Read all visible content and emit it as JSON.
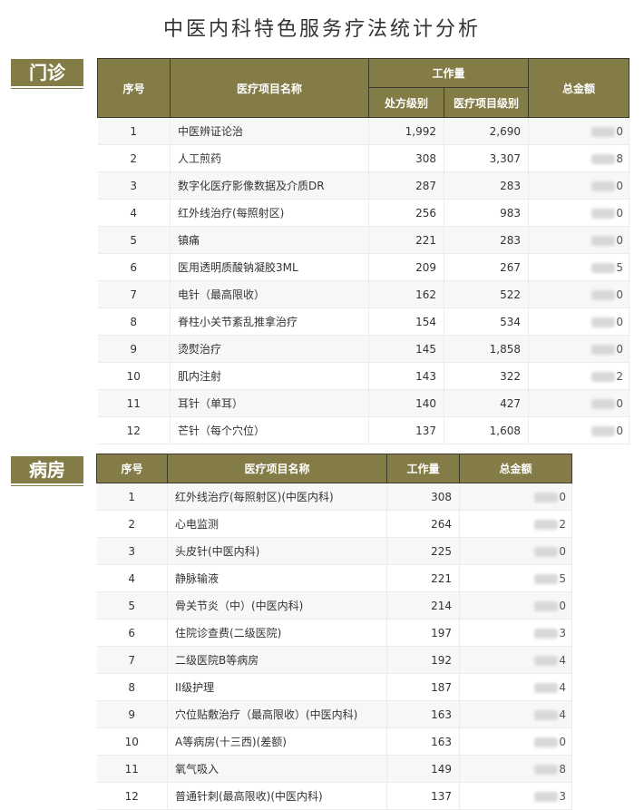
{
  "title": "中医内科特色服务疗法统计分析",
  "outpatient": {
    "label": "门诊",
    "headers": {
      "index": "序号",
      "name": "医疗项目名称",
      "workload": "工作量",
      "rx_level": "处方级别",
      "item_level": "医疗项目级别",
      "amount": "总金额"
    },
    "rows": [
      {
        "idx": "1",
        "name": "中医辨证论治",
        "rx": "1,992",
        "item": "2,690",
        "amt_last": "0"
      },
      {
        "idx": "2",
        "name": "人工煎药",
        "rx": "308",
        "item": "3,307",
        "amt_last": "8"
      },
      {
        "idx": "3",
        "name": "数字化医疗影像数据及介质DR",
        "rx": "287",
        "item": "283",
        "amt_last": "0"
      },
      {
        "idx": "4",
        "name": "红外线治疗(每照射区)",
        "rx": "256",
        "item": "983",
        "amt_last": "0"
      },
      {
        "idx": "5",
        "name": "镇痛",
        "rx": "221",
        "item": "283",
        "amt_last": "0"
      },
      {
        "idx": "6",
        "name": "医用透明质酸钠凝胶3ML",
        "rx": "209",
        "item": "267",
        "amt_last": "5"
      },
      {
        "idx": "7",
        "name": "电针（最高限收）",
        "rx": "162",
        "item": "522",
        "amt_last": "0"
      },
      {
        "idx": "8",
        "name": "脊柱小关节紊乱推拿治疗",
        "rx": "154",
        "item": "534",
        "amt_last": "0"
      },
      {
        "idx": "9",
        "name": "烫熨治疗",
        "rx": "145",
        "item": "1,858",
        "amt_last": "0"
      },
      {
        "idx": "10",
        "name": "肌内注射",
        "rx": "143",
        "item": "322",
        "amt_last": "2"
      },
      {
        "idx": "11",
        "name": "耳针（单耳）",
        "rx": "140",
        "item": "427",
        "amt_last": "0"
      },
      {
        "idx": "12",
        "name": "芒针（每个穴位）",
        "rx": "137",
        "item": "1,608",
        "amt_last": "0"
      }
    ]
  },
  "ward": {
    "label": "病房",
    "headers": {
      "index": "序号",
      "name": "医疗项目名称",
      "workload": "工作量",
      "amount": "总金额"
    },
    "rows": [
      {
        "idx": "1",
        "name": "红外线治疗(每照射区)(中医内科)",
        "work": "308",
        "amt_last": "0"
      },
      {
        "idx": "2",
        "name": "心电监测",
        "work": "264",
        "amt_last": "2"
      },
      {
        "idx": "3",
        "name": "头皮针(中医内科)",
        "work": "225",
        "amt_last": "0"
      },
      {
        "idx": "4",
        "name": "静脉输液",
        "work": "221",
        "amt_last": "5"
      },
      {
        "idx": "5",
        "name": "骨关节炎（中）(中医内科)",
        "work": "214",
        "amt_last": "0"
      },
      {
        "idx": "6",
        "name": "住院诊查费(二级医院)",
        "work": "197",
        "amt_last": "3"
      },
      {
        "idx": "7",
        "name": "二级医院B等病房",
        "work": "192",
        "amt_last": "4"
      },
      {
        "idx": "8",
        "name": "II级护理",
        "work": "187",
        "amt_last": "4"
      },
      {
        "idx": "9",
        "name": "穴位贴敷治疗（最高限收）(中医内科)",
        "work": "163",
        "amt_last": "4"
      },
      {
        "idx": "10",
        "name": "A等病房(十三西)(差额)",
        "work": "163",
        "amt_last": "0"
      },
      {
        "idx": "11",
        "name": "氧气吸入",
        "work": "149",
        "amt_last": "8"
      },
      {
        "idx": "12",
        "name": "普通针刺(最高限收)(中医内科)",
        "work": "137",
        "amt_last": "3"
      }
    ]
  }
}
